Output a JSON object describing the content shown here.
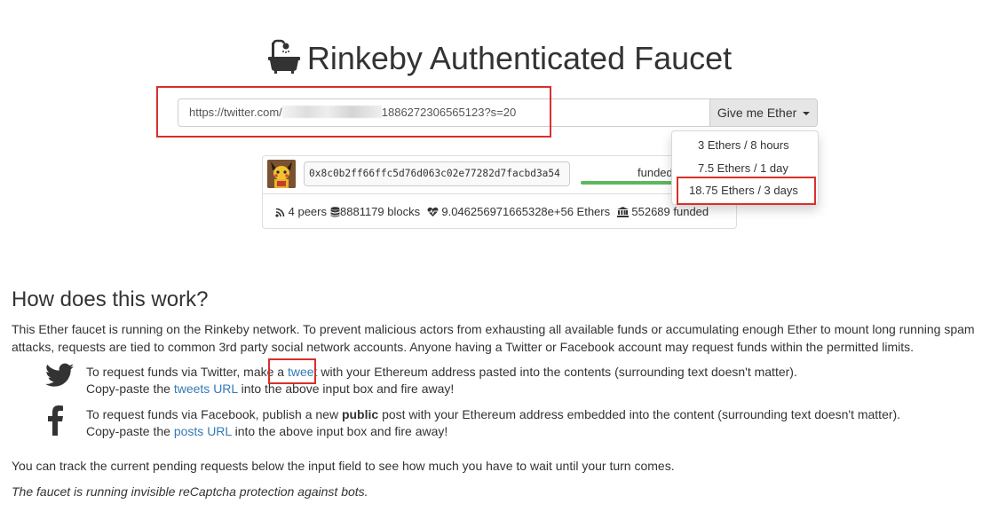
{
  "header": {
    "title": "Rinkeby Authenticated Faucet",
    "icon": "bath-icon"
  },
  "request_form": {
    "url_value_prefix": "https://twitter.com/",
    "url_value_suffix": "1886272306565123?s=20",
    "submit_label": "Give me Ether"
  },
  "dropdown": {
    "options": [
      "3 Ethers / 8 hours",
      "7.5 Ethers / 1 day",
      "18.75 Ethers / 3 days"
    ],
    "highlighted_index": 2
  },
  "status": {
    "address": "0x8c0b2ff66ffc5d76d063c02e77282d7facbd3a54",
    "funded_label": "funded",
    "progress_fraction": 1.0,
    "peers": "4 peers",
    "blocks": "8881179 blocks",
    "ethers": "9.046256971665328e+56 Ethers",
    "funded_count": "552689 funded"
  },
  "how": {
    "title": "How does this work?",
    "intro": "This Ether faucet is running on the Rinkeby network. To prevent malicious actors from exhausting all available funds or accumulating enough Ether to mount long running spam attacks, requests are tied to common 3rd party social network accounts. Anyone having a Twitter or Facebook account may request funds within the permitted limits.",
    "twitter": {
      "line1_pre": "To request funds via Twitter, make a ",
      "line1_link": "tweet",
      "line1_post": " with your Ethereum address pasted into the contents (surrounding text doesn't matter).",
      "line2_pre": "Copy-paste the ",
      "line2_link": "tweets URL",
      "line2_post": " into the above input box and fire away!"
    },
    "facebook": {
      "line1_pre": "To request funds via Facebook, publish a new ",
      "line1_bold": "public",
      "line1_post": " post with your Ethereum address embedded into the content (surrounding text doesn't matter).",
      "line2_pre": "Copy-paste the ",
      "line2_link": "posts URL",
      "line2_post": " into the above input box and fire away!"
    },
    "pending_note": "You can track the current pending requests below the input field to see how much you have to wait until your turn comes.",
    "captcha_note": "The faucet is running invisible reCaptcha protection against bots."
  },
  "colors": {
    "link": "#337ab7",
    "highlight": "#d9302b",
    "progress": "#5cb85c"
  }
}
